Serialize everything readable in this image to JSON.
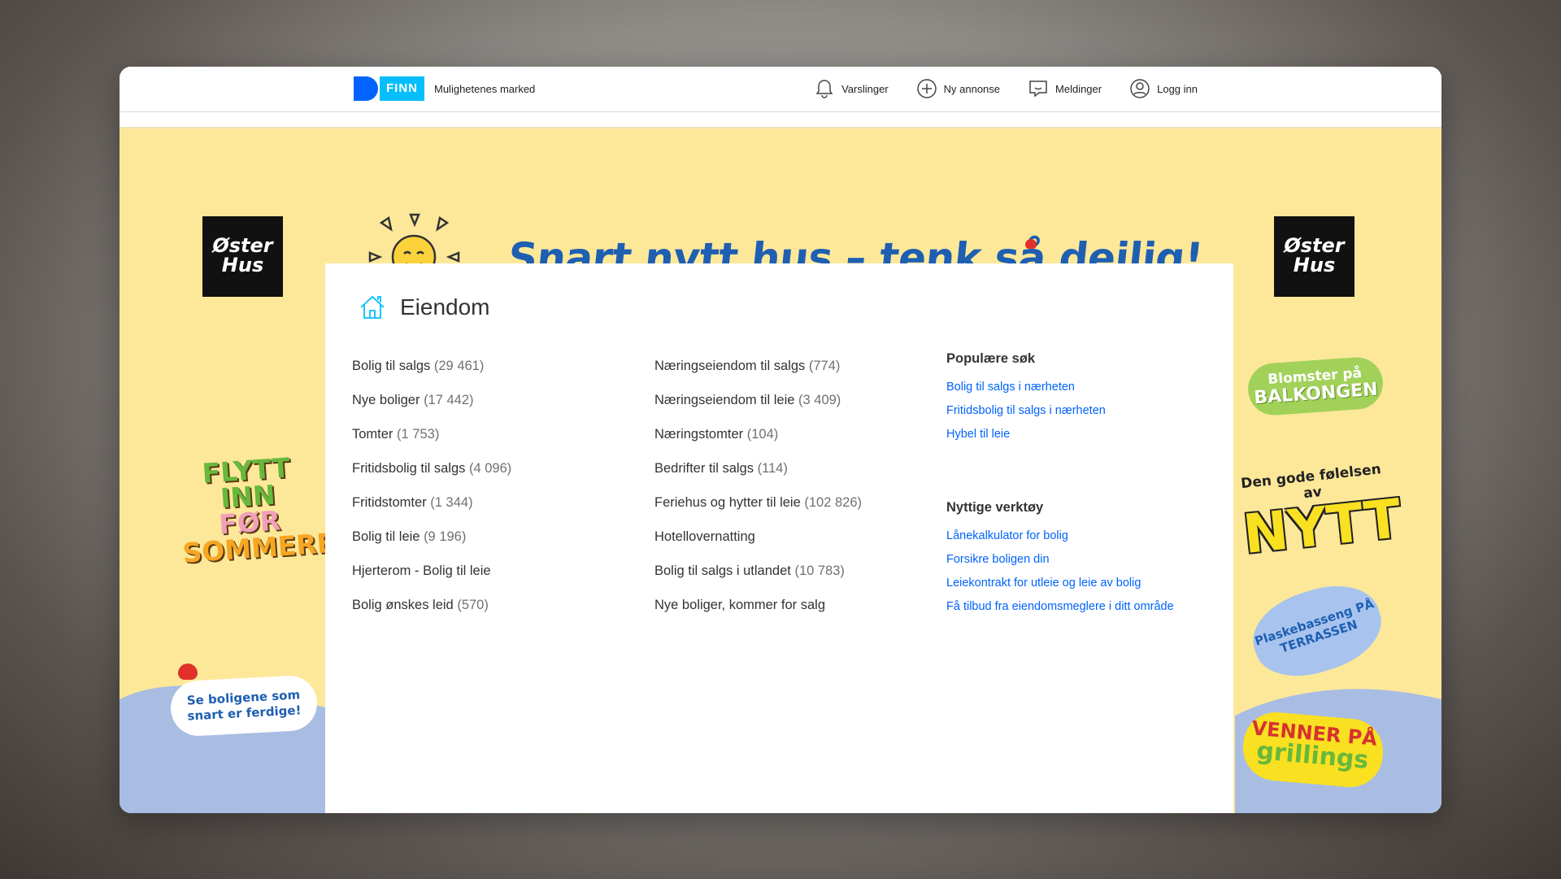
{
  "header": {
    "logo_text": "FINN",
    "tagline": "Mulighetenes marked",
    "nav": [
      {
        "label": "Varslinger",
        "icon": "bell-icon"
      },
      {
        "label": "Ny annonse",
        "icon": "plus-circle-icon"
      },
      {
        "label": "Meldinger",
        "icon": "chat-icon"
      },
      {
        "label": "Logg inn",
        "icon": "user-icon"
      }
    ]
  },
  "ad": {
    "brand": "Øster Hus",
    "headline": "Snart nytt hus – tenk så deilig!",
    "stickers": {
      "flytt": [
        "FLYTT",
        "INN",
        "FØR",
        "SOMMEREN!"
      ],
      "se": "Se boligene som snart er ferdige!",
      "blomster_small": "Blomster på",
      "blomster_big": "BALKONGEN",
      "nytt_small": "Den gode følelsen av",
      "nytt_big": "NYTT",
      "plask": "Plaskebasseng PÅ TERRASSEN",
      "venner_top": "VENNER PÅ",
      "venner_bottom": "grillings"
    },
    "colors": {
      "background": "#fde89a",
      "wave": "#a9bde3",
      "headline": "#1e5fb2"
    }
  },
  "main": {
    "title": "Eiendom",
    "column1": [
      {
        "label": "Bolig til salgs",
        "count": "(29 461)"
      },
      {
        "label": "Nye boliger",
        "count": "(17 442)"
      },
      {
        "label": "Tomter",
        "count": "(1 753)"
      },
      {
        "label": "Fritidsbolig til salgs",
        "count": "(4 096)"
      },
      {
        "label": "Fritidstomter",
        "count": "(1 344)"
      },
      {
        "label": "Bolig til leie",
        "count": "(9 196)"
      },
      {
        "label": "Hjerterom - Bolig til leie",
        "count": ""
      },
      {
        "label": "Bolig ønskes leid",
        "count": "(570)"
      }
    ],
    "column2": [
      {
        "label": "Næringseiendom til salgs",
        "count": "(774)"
      },
      {
        "label": "Næringseiendom til leie",
        "count": "(3 409)"
      },
      {
        "label": "Næringstomter",
        "count": "(104)"
      },
      {
        "label": "Bedrifter til salgs",
        "count": "(114)"
      },
      {
        "label": "Feriehus og hytter til leie",
        "count": "(102 826)"
      },
      {
        "label": "Hotellovernatting",
        "count": ""
      },
      {
        "label": "Bolig til salgs i utlandet",
        "count": "(10 783)"
      },
      {
        "label": "Nye boliger, kommer for salg",
        "count": ""
      }
    ],
    "popular_title": "Populære søk",
    "popular": [
      "Bolig til salgs i nærheten",
      "Fritidsbolig til salgs i nærheten",
      "Hybel til leie"
    ],
    "tools_title": "Nyttige verktøy",
    "tools": [
      "Lånekalkulator for bolig",
      "Forsikre boligen din",
      "Leiekontrakt for utleie og leie av bolig",
      "Få tilbud fra eiendomsmeglere i ditt område"
    ]
  }
}
